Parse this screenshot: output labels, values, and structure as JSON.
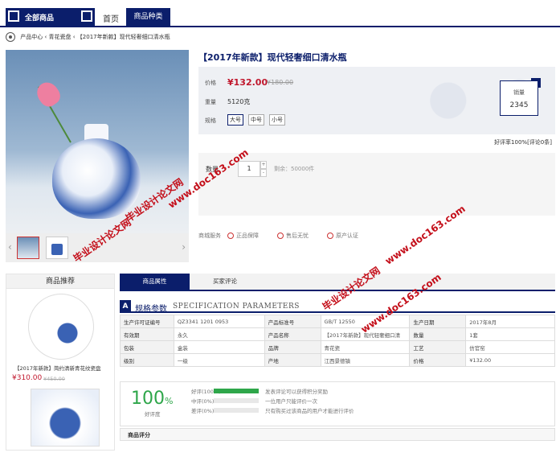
{
  "nav": {
    "all_categories": "全部商品",
    "home": "首页",
    "category": "商品种类"
  },
  "breadcrumb": {
    "root": "产品中心",
    "sep1": "‹",
    "level1": "青花瓷盘",
    "sep2": "‹",
    "current": "【2017年新款】现代轻奢细口清水瓶"
  },
  "product": {
    "title": "【2017年新款】现代轻奢细口清水瓶",
    "price_label": "价格",
    "price": "¥132.00",
    "old_price": "¥180.00",
    "weight_label": "重量",
    "weight": "5120克",
    "size_label": "规格",
    "sizes": [
      "大号",
      "中号",
      "小号"
    ],
    "sales_label": "销量",
    "sales": "2345",
    "good_rate": "好评率100%[评论0条]",
    "qty_label": "数量",
    "qty": "1",
    "stock": "剩余：50000件",
    "service_label": "商城服务",
    "services": [
      "正品保障",
      "售后无忧",
      "原产认证"
    ]
  },
  "thumbs": {
    "prev": "‹",
    "next": "›"
  },
  "recommend": {
    "title": "商品推荐",
    "item_name": "【2017年新款】简约清新青花纹瓷盘",
    "item_price": "¥310.00",
    "item_old_price": "¥450.00"
  },
  "tabs": {
    "active": "商品属性",
    "other": "买家评论"
  },
  "spec": {
    "letter": "A",
    "title_cn": "规格参数",
    "title_en": "SPECIFICATION PARAMETERS",
    "rows": [
      [
        "生产许可证编号",
        "QZ3341 1201 0953",
        "产品标准号",
        "GB/T 12550",
        "生产日期",
        "2017年8月"
      ],
      [
        "有效期",
        "永久",
        "产品名称",
        "【2017年新款】现代轻奢细口清",
        "数量",
        "1套"
      ],
      [
        "包装",
        "盒装",
        "品牌",
        "青花瓷",
        "工艺",
        "仿官窑"
      ],
      [
        "级别",
        "一级",
        "产地",
        "江西景德镇",
        "价格",
        "¥132.00"
      ]
    ]
  },
  "rating": {
    "score": "100",
    "unit": "%",
    "sub": "好评度",
    "good": "好评(100%)",
    "good_fill": 100,
    "mid": "中评(0%)",
    "bad": "差评(0%)",
    "note1": "发表评论可以获得积分奖励",
    "note2": "一位用户只能评价一次",
    "note3": "只有购买过该商品的用户才能进行评价"
  },
  "review_header": "商品评分",
  "watermarks": {
    "w1": "www.doc163.com",
    "w2": "毕业设计论文网",
    "w3": "毕业设计论文网",
    "w4": "www.doc163.com",
    "w5": "毕业设计论文网",
    "w6": "www.doc163.com"
  },
  "colors": {
    "navy": "#0b1e6b",
    "price_red": "#c0162c",
    "rate_green": "#2ea64a"
  }
}
